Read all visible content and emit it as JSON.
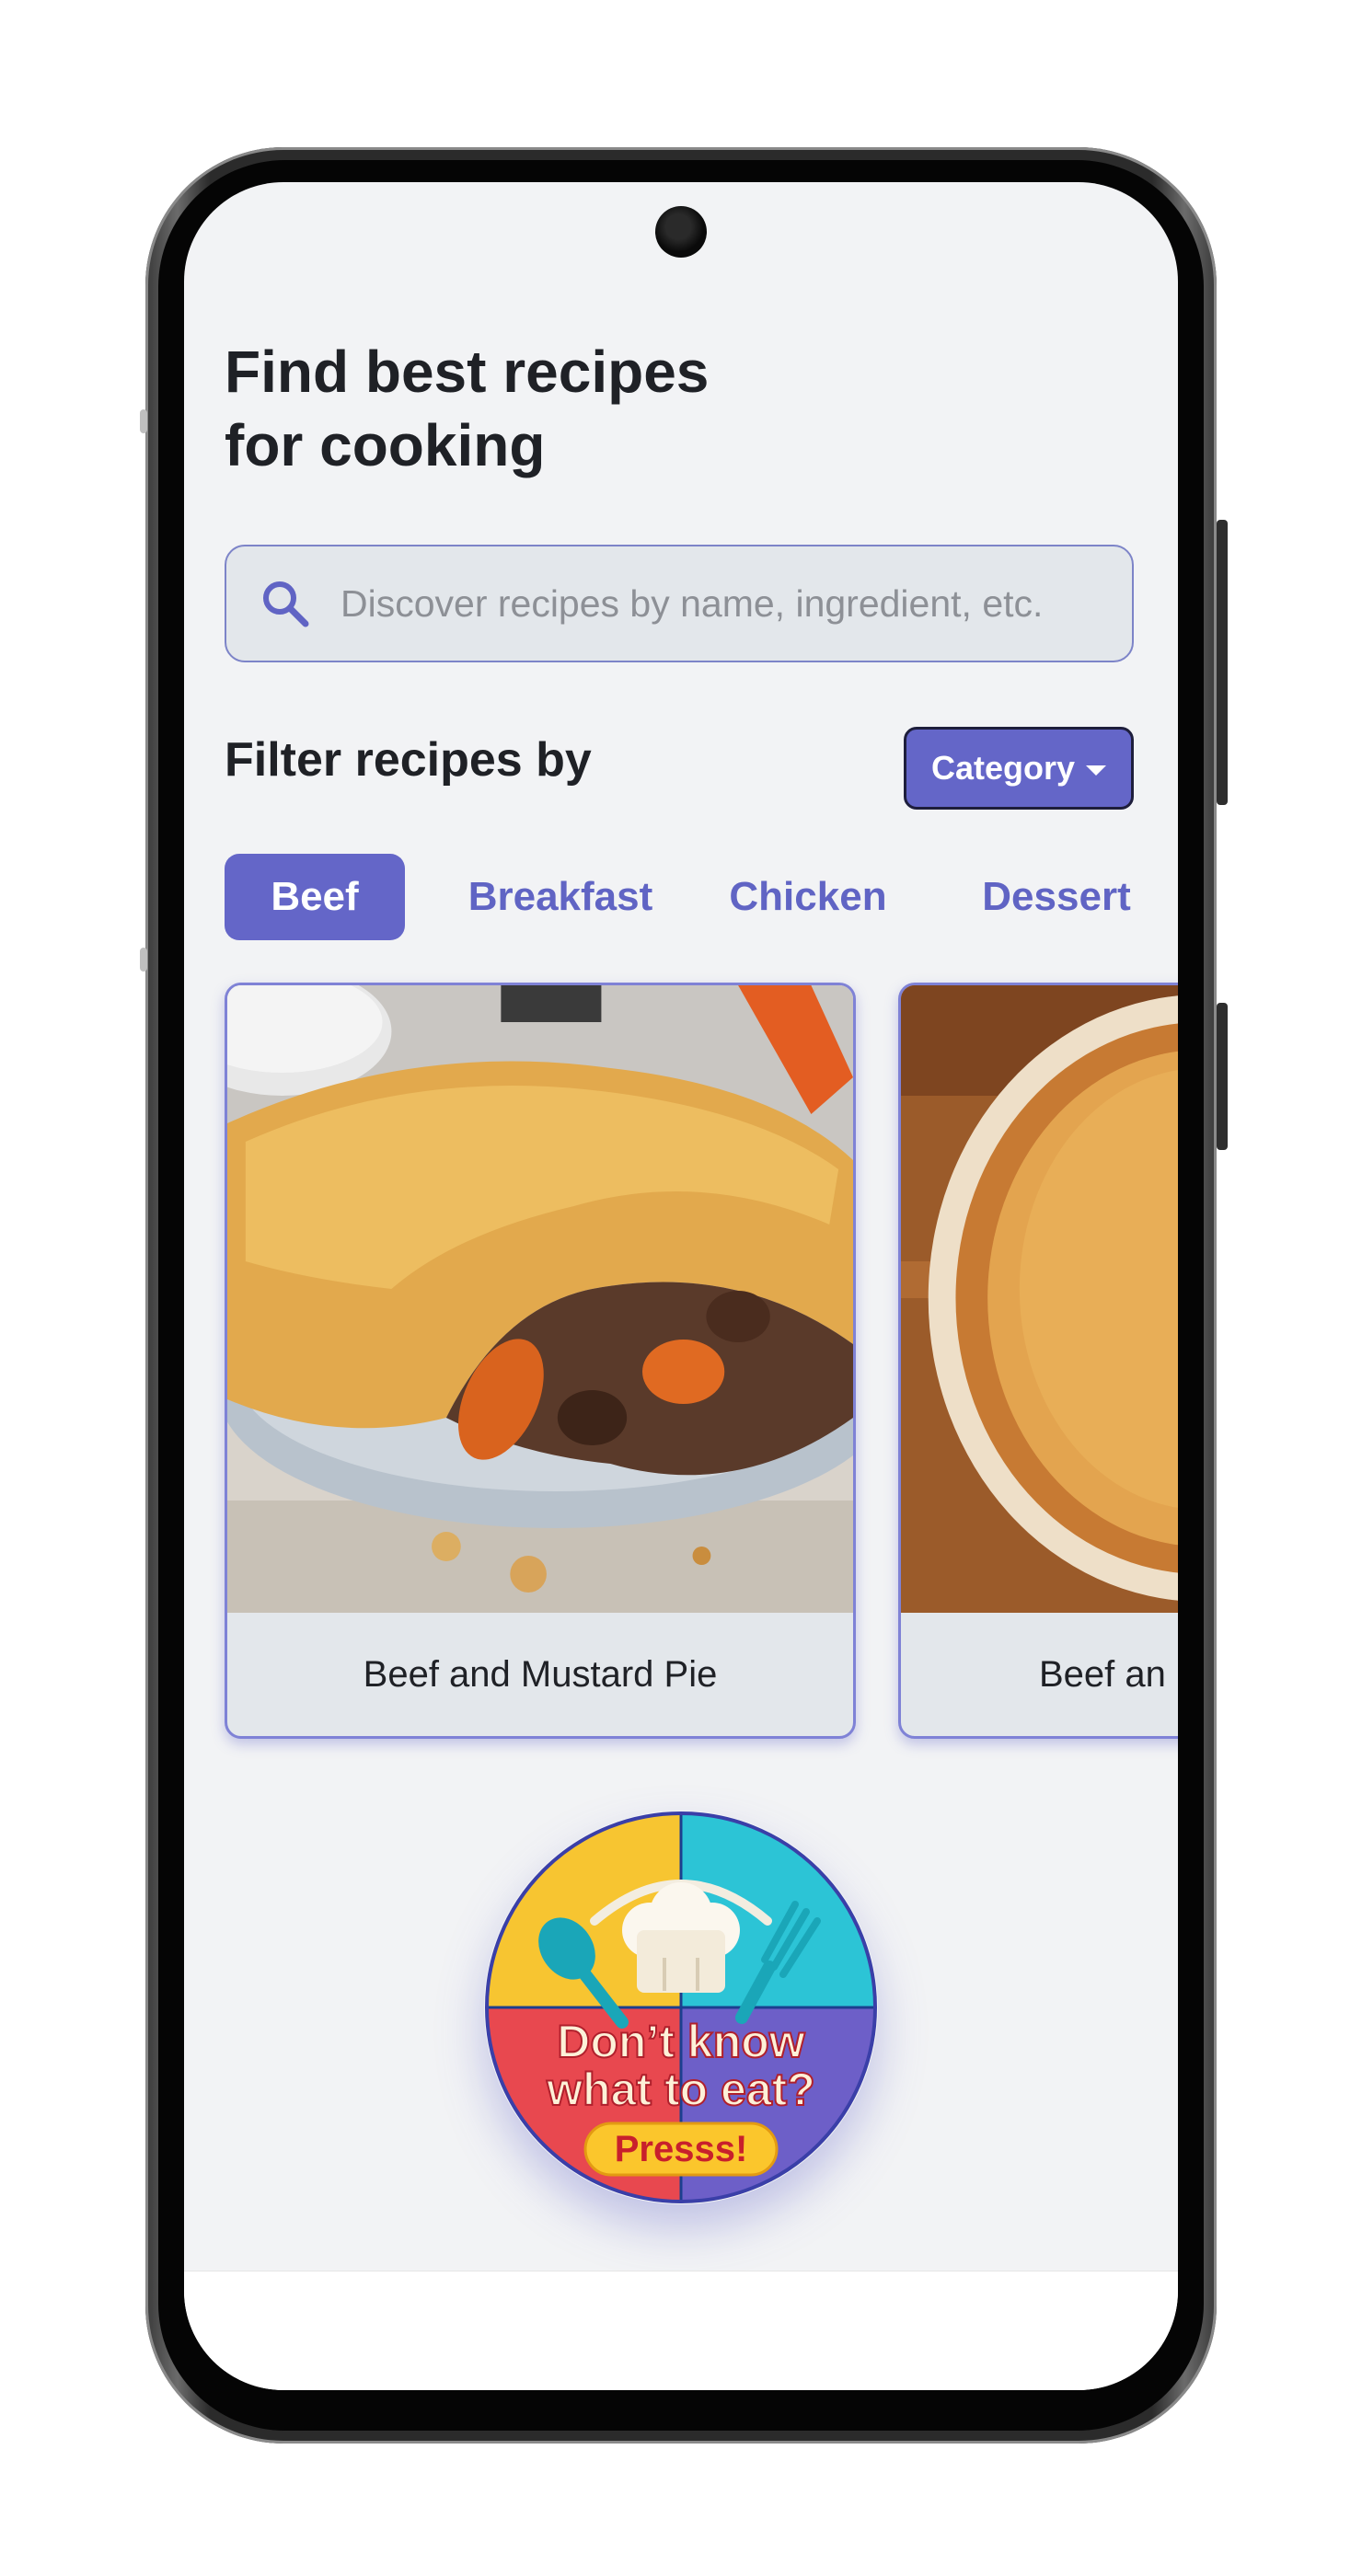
{
  "header": {
    "title_line1": "Find best recipes",
    "title_line2": "for cooking"
  },
  "search": {
    "placeholder": "Discover recipes by name, ingredient, etc."
  },
  "filter": {
    "label": "Filter recipes by",
    "dropdown_label": "Category"
  },
  "categories": [
    {
      "label": "Beef",
      "active": true
    },
    {
      "label": "Breakfast",
      "active": false
    },
    {
      "label": "Chicken",
      "active": false
    },
    {
      "label": "Dessert",
      "active": false
    }
  ],
  "recipes": [
    {
      "name": "Beef and Mustard Pie"
    },
    {
      "name": "Beef an"
    }
  ],
  "random_button": {
    "line1": "Don’t know",
    "line2": "what to eat?",
    "pill": "Presss!"
  },
  "colors": {
    "accent": "#6466c8",
    "background": "#f2f3f5",
    "card_bg": "#e3e7eb",
    "text": "#1f2126"
  }
}
